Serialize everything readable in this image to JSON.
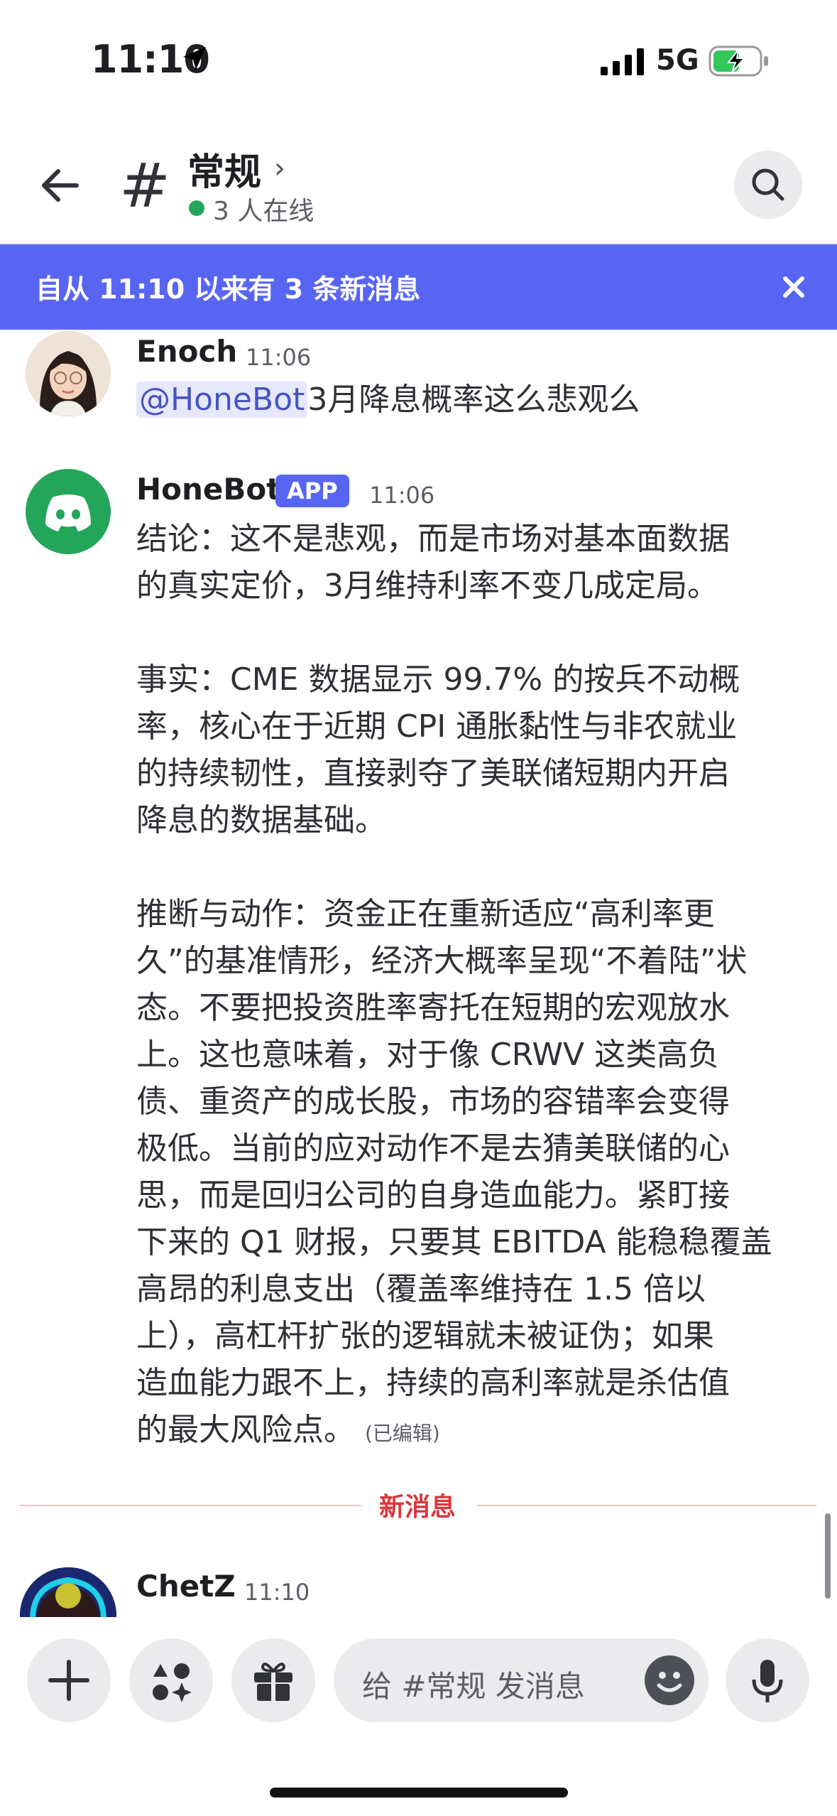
{
  "status_bar": {
    "time": "11:10",
    "network": "5G"
  },
  "header": {
    "channel_name": "常规",
    "chevron": "›",
    "hash_symbol": "#",
    "online_text": "3 人在线",
    "icons": [
      "back-arrow-icon",
      "search-icon"
    ]
  },
  "banner": {
    "text": "自从 11:10 以来有 3 条新消息",
    "close_label": "×"
  },
  "messages": [
    {
      "username": "Enoch",
      "time": "11:06",
      "mention": "@HoneBot",
      "text": "3月降息概率这么悲观么"
    },
    {
      "username": "HoneBot",
      "badge": "APP",
      "time": "11:06",
      "lines": [
        "结论：这不是悲观，而是市场对基本面数据",
        "的真实定价，3月维持利率不变几成定局。",
        "",
        "事实：CME 数据显示 99.7% 的按兵不动概",
        "率，核心在于近期 CPI 通胀黏性与非农就业",
        "的持续韧性，直接剥夺了美联储短期内开启",
        "降息的数据基础。",
        "",
        "推断与动作：资金正在重新适应“高利率更",
        "久”的基准情形，经济大概率呈现“不着陆”状",
        "态。不要把投资胜率寄托在短期的宏观放水",
        "上。这也意味着，对于像 CRWV 这类高负",
        "债、重资产的成长股，市场的容错率会变得",
        "极低。当前的应对动作不是去猜美联储的心",
        "思，而是回归公司的自身造血能力。紧盯接",
        "下来的 Q1 财报，只要其 EBITDA 能稳稳覆盖",
        "高昂的利息支出（覆盖率维持在 1.5 倍以",
        "上），高杠杆扩张的逻辑就未被证伪；如果",
        "造血能力跟不上，持续的高利率就是杀估值"
      ],
      "last_line": "的最大风险点。",
      "edited": "(已编辑)"
    },
    {
      "username": "ChetZ",
      "time": "11:10"
    }
  ],
  "new_messages_divider": "新消息",
  "composer": {
    "placeholder": "给 #常规 发消息",
    "plus_label": "+"
  },
  "colors": {
    "brand": "#5865f2",
    "online": "#23a55a",
    "new_divider": "#da373c",
    "mention_bg": "#e6e8fd"
  }
}
